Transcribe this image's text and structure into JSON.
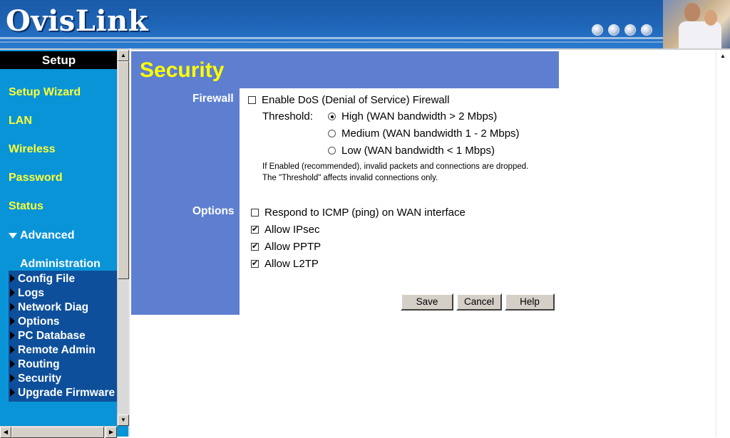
{
  "header": {
    "logo": "OvisLink"
  },
  "sidebar": {
    "title": "Setup",
    "items": [
      {
        "label": "Setup Wizard"
      },
      {
        "label": "LAN"
      },
      {
        "label": "Wireless"
      },
      {
        "label": "Password"
      },
      {
        "label": "Status"
      }
    ],
    "advanced": "Advanced",
    "administration": "Administration",
    "submenu": [
      {
        "label": "Config File"
      },
      {
        "label": "Logs"
      },
      {
        "label": "Network Diag"
      },
      {
        "label": "Options"
      },
      {
        "label": "PC Database"
      },
      {
        "label": "Remote Admin"
      },
      {
        "label": "Routing"
      },
      {
        "label": "Security"
      },
      {
        "label": "Upgrade Firmware"
      }
    ]
  },
  "page": {
    "title": "Security",
    "firewall": {
      "section_label": "Firewall",
      "enable_label": "Enable DoS (Denial of Service) Firewall",
      "enable_checked": false,
      "threshold_label": "Threshold:",
      "options": [
        {
          "label": "High (WAN bandwidth > 2 Mbps)",
          "selected": true
        },
        {
          "label": "Medium (WAN bandwidth 1 - 2 Mbps)",
          "selected": false
        },
        {
          "label": "Low (WAN bandwidth < 1 Mbps)",
          "selected": false
        }
      ],
      "note_line1": "If Enabled (recommended), invalid packets and connections are dropped.",
      "note_line2": "The \"Threshold\" affects invalid connections only."
    },
    "options": {
      "section_label": "Options",
      "items": [
        {
          "label": "Respond to ICMP (ping) on WAN interface",
          "checked": false
        },
        {
          "label": "Allow IPsec",
          "checked": true
        },
        {
          "label": "Allow PPTP",
          "checked": true
        },
        {
          "label": "Allow L2TP",
          "checked": true
        }
      ]
    },
    "buttons": {
      "save": "Save",
      "cancel": "Cancel",
      "help": "Help"
    }
  }
}
